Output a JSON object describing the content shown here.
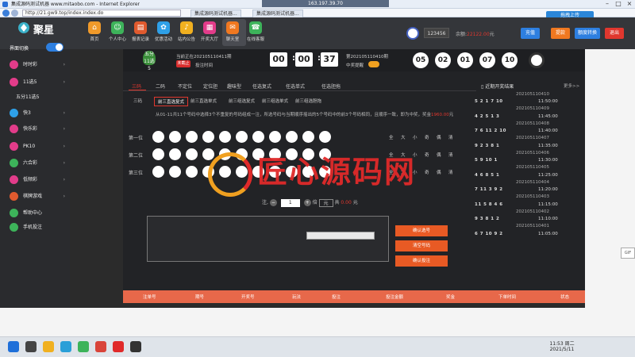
{
  "window": {
    "title": "集成源码测试机器 www.mitaobo.com - Internet Explorer",
    "address": "http://21.gw9.top/index.index.do",
    "tab1": "集成源码测试机器...",
    "tab2": "集成源码测试机器...",
    "remote_host": "163.197.39.70",
    "cloud_upload": "拖拽上传"
  },
  "header": {
    "logo": "聚星",
    "nav": [
      {
        "label": "首页",
        "color": "#f09a2a",
        "icon": "⌂"
      },
      {
        "label": "个人中心",
        "color": "#3db35a",
        "icon": "☺"
      },
      {
        "label": "报表记录",
        "color": "#e05a2e",
        "icon": "▤"
      },
      {
        "label": "优惠活动",
        "color": "#2ea0e8",
        "icon": "✿"
      },
      {
        "label": "站内公告",
        "color": "#f0b020",
        "icon": "♪"
      },
      {
        "label": "开奖大厅",
        "color": "#e23c8a",
        "icon": "▦"
      },
      {
        "label": "聊天室",
        "color": "#f07820",
        "icon": "✉"
      },
      {
        "label": "在线客服",
        "color": "#3db35a",
        "icon": "☎"
      }
    ],
    "username": "123456",
    "balance_label": "余额:",
    "balance_value": "22122.00",
    "balance_unit": "元",
    "btn_recharge": "充值",
    "btn_withdraw": "提款",
    "btn_transfer": "额度转换",
    "btn_logout": "退出"
  },
  "sidebar": {
    "lobby_label": "界面切换",
    "items": [
      {
        "label": "时时彩",
        "color": "#e23c8a"
      },
      {
        "label": "11选5",
        "color": "#e23c8a"
      },
      {
        "label": "五分11选5",
        "color": ""
      },
      {
        "label": "快3",
        "color": "#2ea0e8"
      },
      {
        "label": "快乐彩",
        "color": "#e23c8a"
      },
      {
        "label": "PK10",
        "color": "#e23c8a"
      },
      {
        "label": "六合彩",
        "color": "#3db35a"
      },
      {
        "label": "低频彩",
        "color": "#e23c8a"
      },
      {
        "label": "棋牌游戏",
        "color": "#e05a2e"
      },
      {
        "label": "帮助中心",
        "color": "#3db35a"
      },
      {
        "label": "手机投注",
        "color": "#3db35a"
      }
    ]
  },
  "draw": {
    "badge": "五分11选5",
    "current_issue": "当前正在202105110411期",
    "stop_tag": "未截止",
    "countdown_label": "投注时间",
    "hh": "00",
    "mm": "00",
    "ss": "37",
    "prev_issue": "第202105110410期",
    "sound_label": "中奖提醒",
    "result": [
      "05",
      "02",
      "01",
      "07",
      "10"
    ]
  },
  "tabs": [
    "三码",
    "二码",
    "不定位",
    "定位胆",
    "趣味型",
    "任选复式",
    "任选单式",
    "任选胆拖"
  ],
  "subtabs": [
    "三码",
    "前三直选复式",
    "前三直选单式",
    "前三组选复式",
    "前三组选单式",
    "前三组选胆拖"
  ],
  "description_prefix": "从01-11共11个号码中选择3个不重复的号码组成一注，所选号码与当期顺序摇出的5个号码中的前3个号码相同，且顺序一致，即为中奖，奖金",
  "description_amount": "1960.00",
  "description_suffix": "元",
  "rows": [
    "第一位",
    "第二位",
    "第三位"
  ],
  "quick_picks": [
    "全",
    "大",
    "小",
    "奇",
    "偶",
    "清"
  ],
  "bet": {
    "zhu_label": "注,",
    "multiplier": "1",
    "bei_label": "倍",
    "unit": "元",
    "total_label": "共",
    "total_amount": "0.00",
    "total_unit": "元"
  },
  "actions": [
    "确认选号",
    "清空号码",
    "确认投注"
  ],
  "table_headers": [
    "注单号",
    "期号",
    "开奖号",
    "玩法",
    "投注",
    "投注金额",
    "奖金",
    "下单时间",
    "状态"
  ],
  "history": {
    "title": "近期开奖结果",
    "more": "更多>>",
    "rows": [
      {
        "issue": "202105110410",
        "nums": "",
        "time": ""
      },
      {
        "issue": "",
        "nums": "5 2 1 7 10",
        "time": "11:50:00"
      },
      {
        "issue": "202105110409",
        "nums": "4 2 5 1 3",
        "time": "11:45:00"
      },
      {
        "issue": "202105110408",
        "nums": "7 6 11 2 10",
        "time": "11:40:00"
      },
      {
        "issue": "202105110407",
        "nums": "9 2 3 8 1",
        "time": "11:35:00"
      },
      {
        "issue": "202105110406",
        "nums": "5 9 10 1",
        "time": "11:30:00"
      },
      {
        "issue": "202105110405",
        "nums": "4 6 8 5 1",
        "time": "11:25:00"
      },
      {
        "issue": "202105110404",
        "nums": "7 11 3 9 2",
        "time": "11:20:00"
      },
      {
        "issue": "202105110403",
        "nums": "11 5 8 4 6",
        "time": "11:15:00"
      },
      {
        "issue": "202105110402",
        "nums": "9 3 8 1 2",
        "time": "11:10:00"
      },
      {
        "issue": "202105110401",
        "nums": "6 7 10 9 2",
        "time": "11:05:00"
      }
    ]
  },
  "watermark": "匠心源码网",
  "taskbar": {
    "time": "11:53 周二",
    "date": "2021/5/11"
  }
}
